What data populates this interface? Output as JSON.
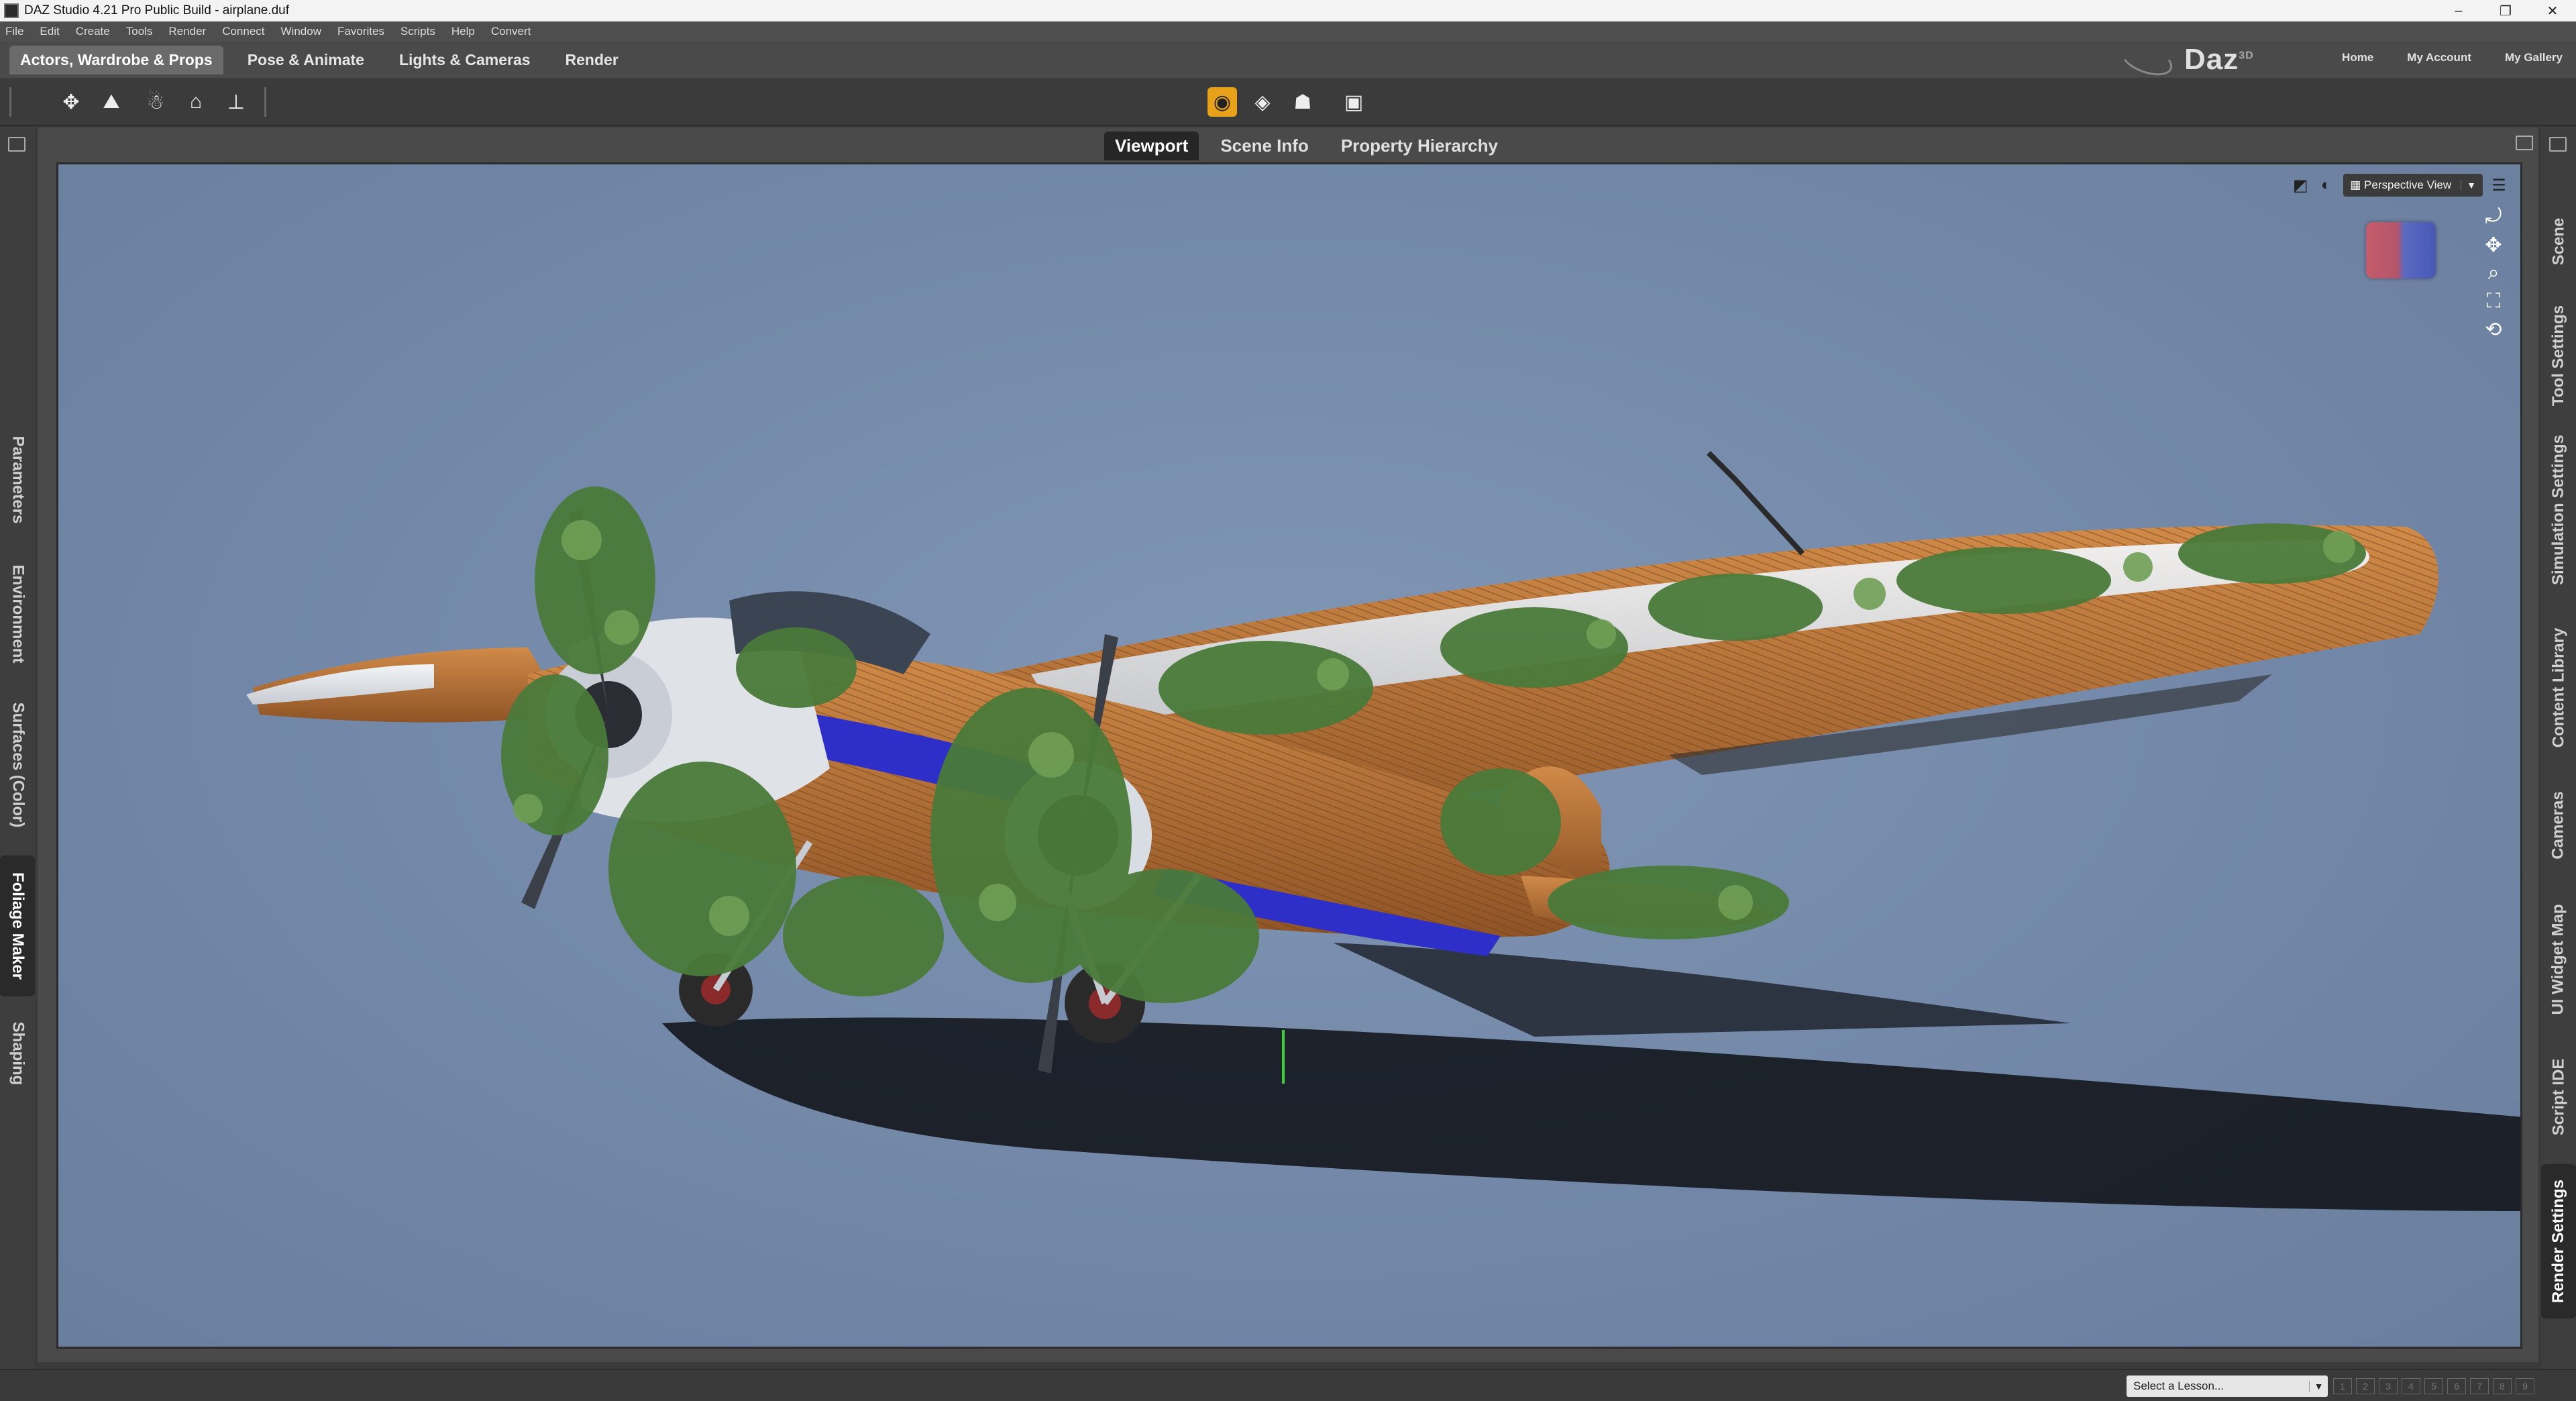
{
  "window": {
    "title": "DAZ Studio 4.21 Pro Public Build - airplane.duf",
    "controls": [
      "–",
      "❐",
      "✕"
    ]
  },
  "menu": [
    "File",
    "Edit",
    "Create",
    "Tools",
    "Render",
    "Connect",
    "Window",
    "Favorites",
    "Scripts",
    "Help",
    "Convert"
  ],
  "activity_tabs": [
    {
      "label": "Actors, Wardrobe & Props",
      "active": true
    },
    {
      "label": "Pose & Animate",
      "active": false
    },
    {
      "label": "Lights & Cameras",
      "active": false
    },
    {
      "label": "Render",
      "active": false
    }
  ],
  "brand": {
    "name": "Daz",
    "superscript": "3D"
  },
  "top_links": [
    "Home",
    "My Account",
    "My Gallery"
  ],
  "viewport_tabs": [
    {
      "label": "Viewport",
      "active": true
    },
    {
      "label": "Scene Info",
      "active": false
    },
    {
      "label": "Property Hierarchy",
      "active": false
    }
  ],
  "view_select": {
    "value": "Perspective View"
  },
  "left_panels": [
    "Parameters",
    "Environment",
    "Surfaces (Color)",
    "Foliage Maker",
    "Shaping"
  ],
  "left_active": "Foliage Maker",
  "right_panels": [
    "Scene",
    "Tool Settings",
    "Simulation Settings",
    "Content Library",
    "Cameras",
    "UI Widget Map",
    "Script IDE",
    "Render Settings"
  ],
  "right_active": "Render Settings",
  "status": {
    "lesson_placeholder": "Select a Lesson...",
    "steps": [
      "1",
      "2",
      "3",
      "4",
      "5",
      "6",
      "7",
      "8",
      "9"
    ]
  },
  "colors": {
    "accent": "#e8a21a",
    "viewport_bg": "#7a8fae",
    "fuselage": "#b8733a",
    "wing_white": "#e9ecef",
    "window_blue": "#2e2ec8",
    "vine_green": "#4a7a3a"
  }
}
